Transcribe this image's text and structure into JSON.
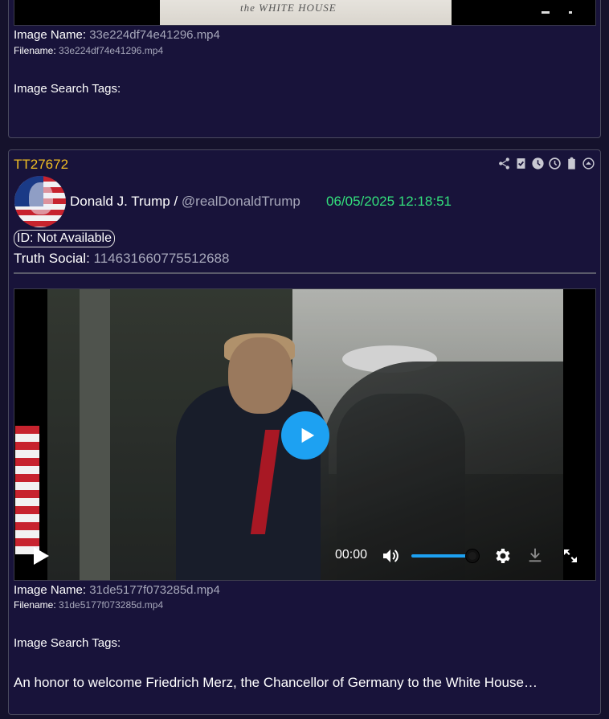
{
  "top_card": {
    "video_watermark": "the WHITE HOUSE",
    "image_name_label": "Image Name:",
    "image_name": "33e224df74e41296.mp4",
    "filename_label": "Filename:",
    "filename": "33e224df74e41296.mp4",
    "tags_label": "Image Search Tags:"
  },
  "post": {
    "id": "TT27672",
    "author_name": "Donald J. Trump /",
    "handle": "@realDonaldTrump",
    "timestamp": "06/05/2025 12:18:51",
    "id_badge": "ID: Not Available",
    "truth_label": "Truth Social:",
    "truth_id": "114631660775512688",
    "toolbar_icons": [
      "share-icon",
      "checklist-icon",
      "clock-filled-icon",
      "clock-outline-icon",
      "clipboard-icon",
      "collapse-icon"
    ],
    "video": {
      "time": "00:00",
      "volume_percent": 85,
      "accent_color": "#1da1f2"
    },
    "image_name_label": "Image Name:",
    "image_name": "31de5177f073285d.mp4",
    "filename_label": "Filename:",
    "filename": "31de5177f073285d.mp4",
    "tags_label": "Image Search Tags:",
    "text": "An honor to welcome Friedrich Merz, the Chancellor of Germany to the White House…"
  },
  "colors": {
    "post_id": "#f0bd24",
    "timestamp": "#33e07c",
    "background": "#18133a"
  }
}
